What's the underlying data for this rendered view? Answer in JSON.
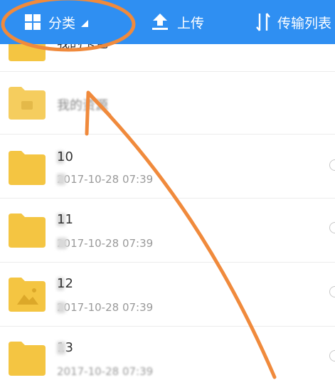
{
  "toolbar": {
    "category_label": "分类",
    "upload_label": "上传",
    "transfer_label": "传输列表"
  },
  "colors": {
    "toolbar_bg": "#2f8ff2",
    "folder": "#f4c542",
    "annotation": "#f08a3c"
  },
  "files": [
    {
      "name": "我的卡包",
      "meta": ""
    },
    {
      "name": "我的资源",
      "meta": ""
    },
    {
      "name": "10",
      "meta": "2017-10-28  07:39"
    },
    {
      "name": "11",
      "meta": "2017-10-28  07:39"
    },
    {
      "name": "12",
      "meta": "2017-10-28  07:39"
    },
    {
      "name": "13",
      "meta": "2017-10-28  07:39"
    }
  ]
}
